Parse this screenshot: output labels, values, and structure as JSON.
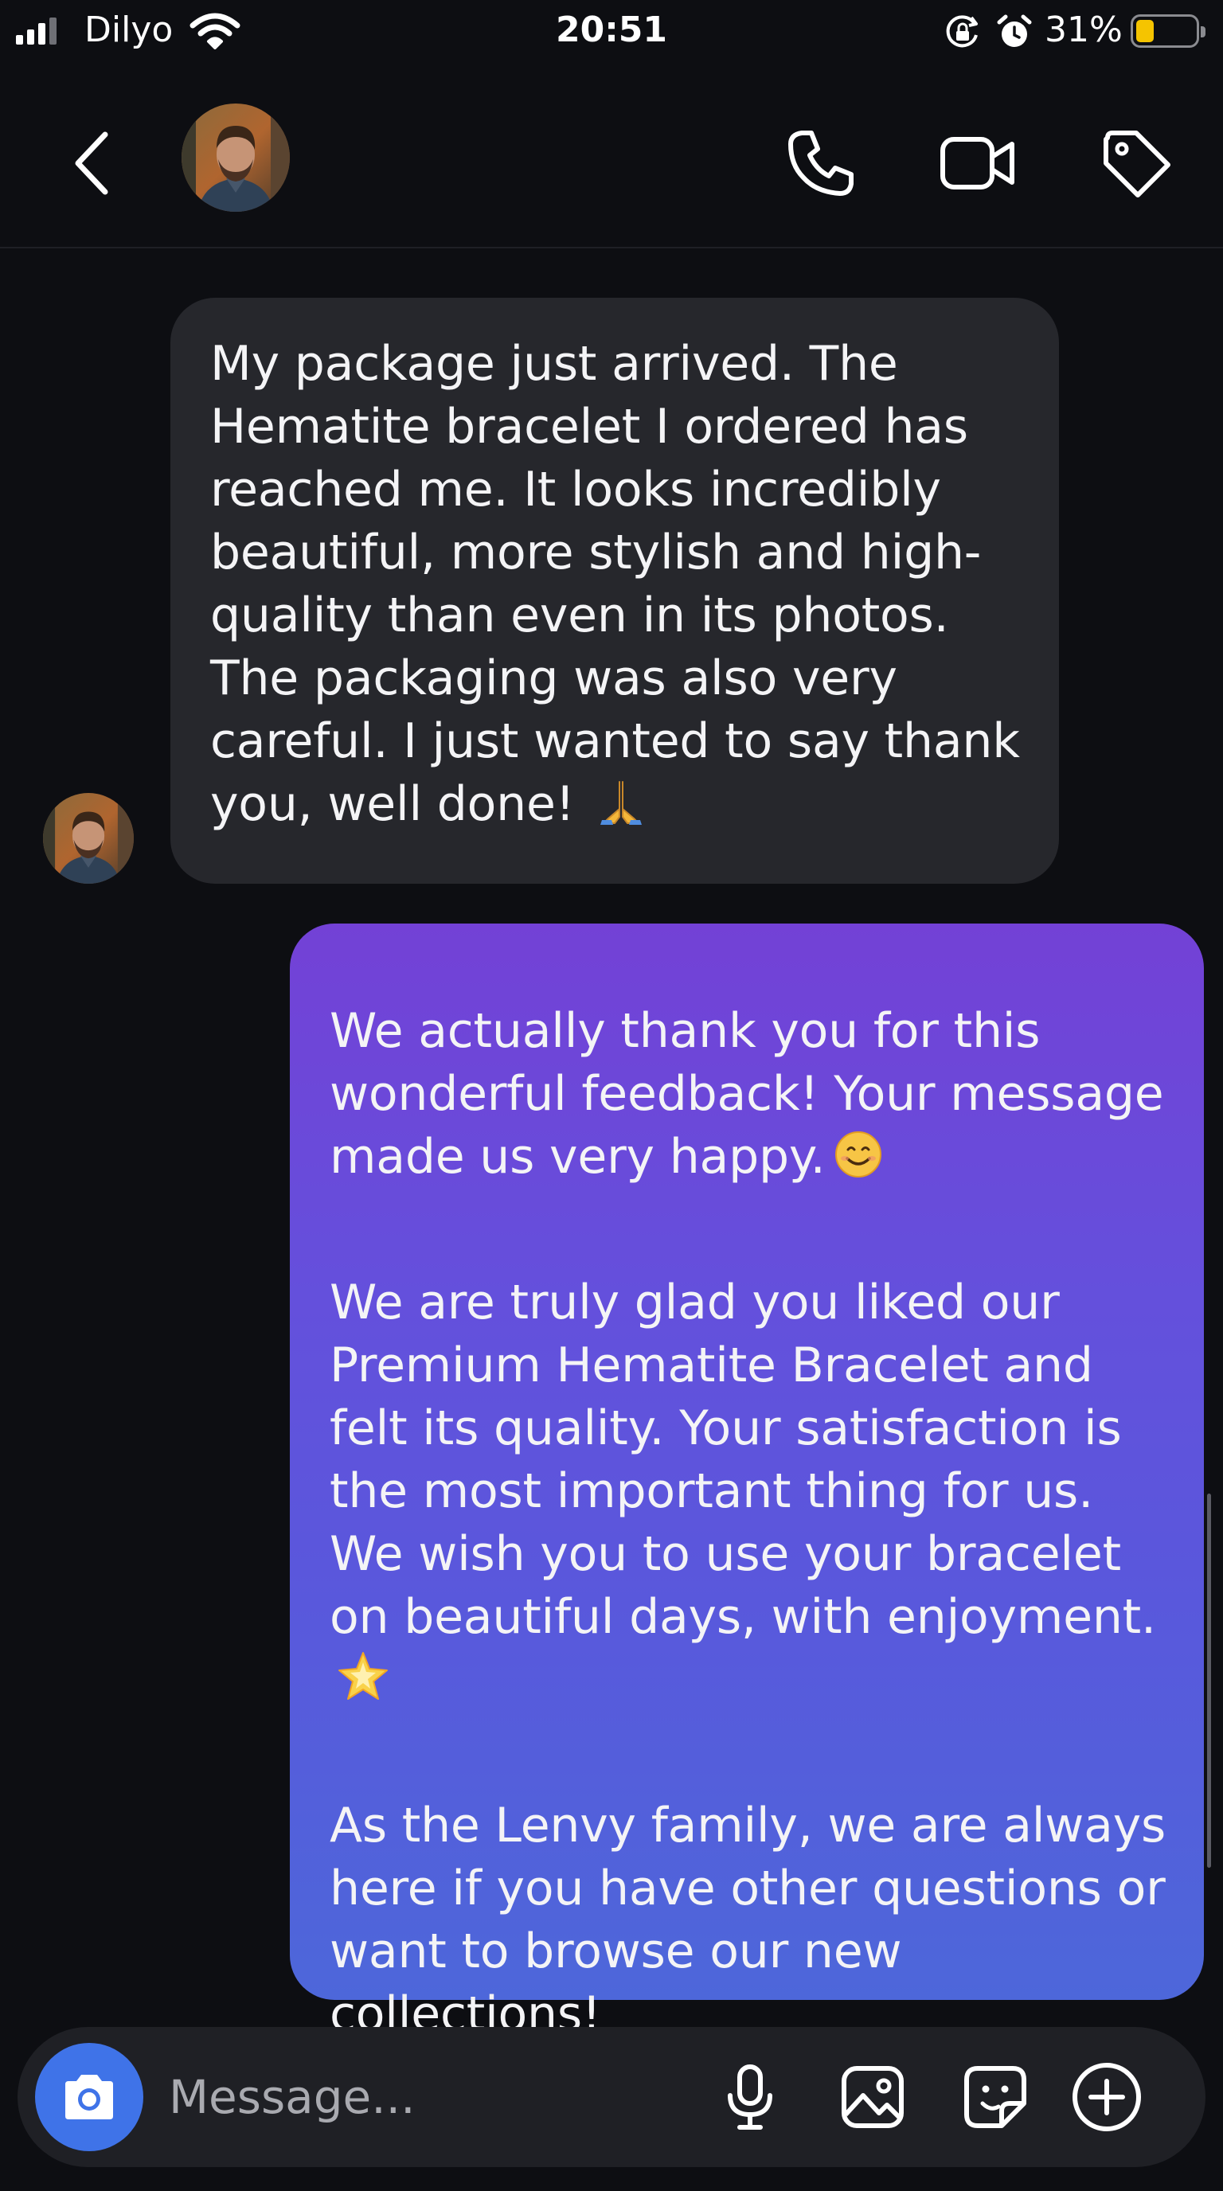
{
  "status_bar": {
    "carrier": "Dilyo",
    "time": "20:51",
    "battery_percent": "31%",
    "battery_level": 0.31,
    "signal_bars_active": 3,
    "signal_bars_total": 4,
    "icons": [
      "signal-icon",
      "wifi-icon",
      "rotation-lock-icon",
      "alarm-icon",
      "battery-icon"
    ]
  },
  "header": {
    "icons": [
      "back-chevron-icon",
      "phone-icon",
      "video-camera-icon",
      "tag-icon"
    ]
  },
  "conversation": {
    "incoming": {
      "text": "My package just arrived. The Hematite bracelet I ordered has reached me. It looks incredibly beautiful, more stylish and high-quality than even in its photos. The packaging was also very careful. I just wanted to say thank you, well done!",
      "emoji": "🙏"
    },
    "outgoing": {
      "paragraphs": [
        "We actually thank you for this wonderful feedback! Your message made us very happy.",
        "We are truly glad you liked our Premium Hematite Bracelet and felt its quality. Your satisfaction is the most important thing for us. We wish you to use your bracelet on beautiful days, with enjoyment.",
        "As the Lenvy family, we are always here if you have other questions or want to browse our new collections!"
      ],
      "emojis": [
        "😊",
        "🌟"
      ]
    }
  },
  "composer": {
    "placeholder": "Message...",
    "icons": [
      "camera-icon",
      "microphone-icon",
      "gallery-icon",
      "sticker-icon",
      "plus-icon"
    ]
  },
  "colors": {
    "background": "#0d0e12",
    "incoming_bubble": "#26272c",
    "outgoing_gradient_top": "#7341d6",
    "outgoing_gradient_bottom": "#4d67da",
    "camera_button": "#3f73e8",
    "battery_fill": "#f5c400"
  }
}
